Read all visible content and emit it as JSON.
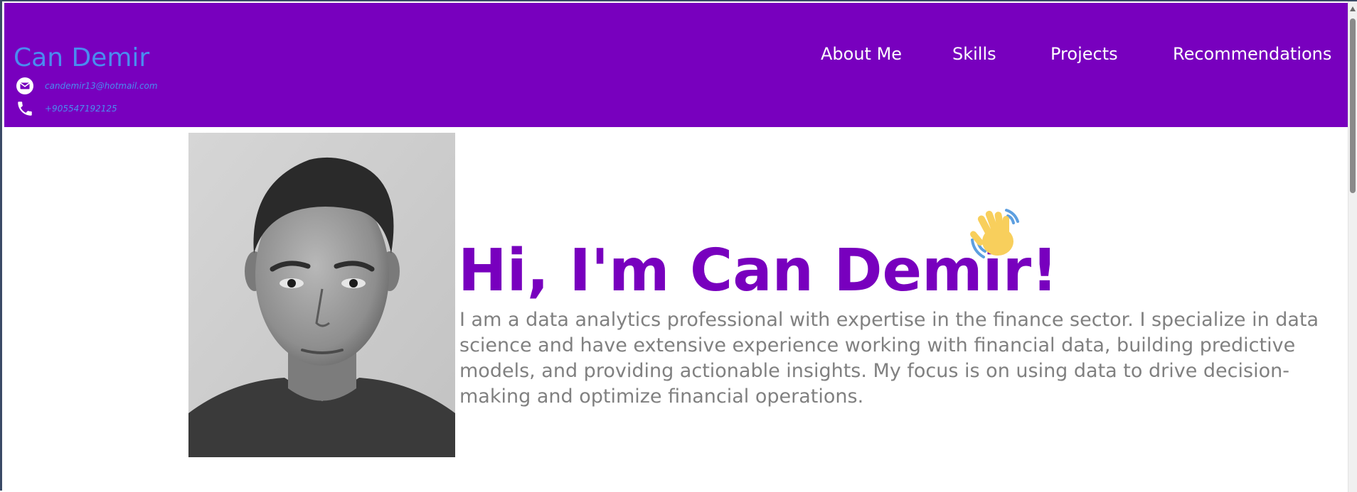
{
  "header": {
    "brand_name": "Can Demir",
    "email": "candemir13@hotmail.com",
    "phone": "+905547192125",
    "nav": [
      "About Me",
      "Skills",
      "Projects",
      "Recommendations"
    ]
  },
  "hero": {
    "title": "Hi, I'm Can Demir!",
    "wave_icon": "waving-hand-icon",
    "intro": "I am a data analytics professional with expertise in the finance sector. I specialize in data science and have extensive experience working with financial data, building predictive models, and providing actionable insights. My focus is on using data to drive decision-making and optimize financial operations."
  },
  "colors": {
    "header_bg": "#7800be",
    "brand_text": "#4a8cf0",
    "title_text": "#7800be",
    "body_text": "#808080"
  }
}
